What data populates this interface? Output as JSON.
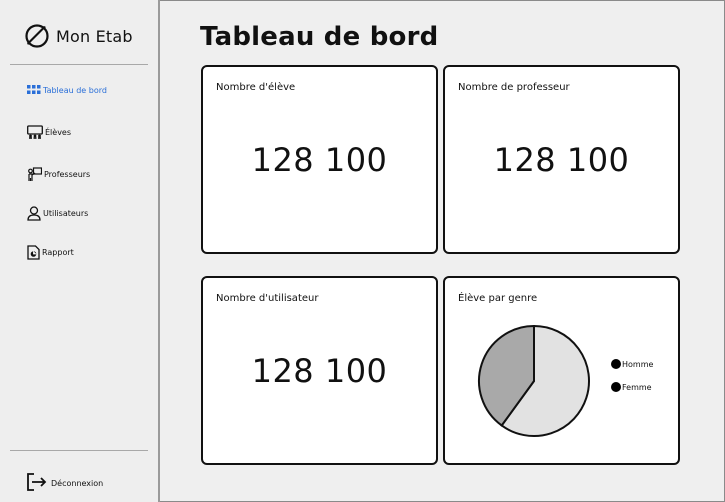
{
  "app": {
    "name": "Mon Etab"
  },
  "sidebar": {
    "items": [
      {
        "label": "Tableau de bord",
        "icon": "grid-icon",
        "active": true
      },
      {
        "label": "Élèves",
        "icon": "students-icon",
        "active": false
      },
      {
        "label": "Professeurs",
        "icon": "teacher-icon",
        "active": false
      },
      {
        "label": "Utilisateurs",
        "icon": "user-icon",
        "active": false
      },
      {
        "label": "Rapport",
        "icon": "report-icon",
        "active": false
      }
    ],
    "logout_label": "Déconnexion"
  },
  "page": {
    "title": "Tableau de bord"
  },
  "cards": {
    "students": {
      "label": "Nombre d'élève",
      "value": "128 100"
    },
    "teachers": {
      "label": "Nombre de professeur",
      "value": "128 100"
    },
    "users": {
      "label": "Nombre d'utilisateur",
      "value": "128 100"
    },
    "gender": {
      "label": "Élève par genre",
      "legend": [
        "Homme",
        "Femme"
      ]
    }
  },
  "chart_data": {
    "type": "pie",
    "categories": [
      "Homme",
      "Femme"
    ],
    "values": [
      60,
      40
    ],
    "colors": [
      "#e2e2e2",
      "#a9a9a9"
    ]
  },
  "colors": {
    "accent": "#2a6fd8",
    "border": "#111111",
    "background": "#efefef"
  }
}
